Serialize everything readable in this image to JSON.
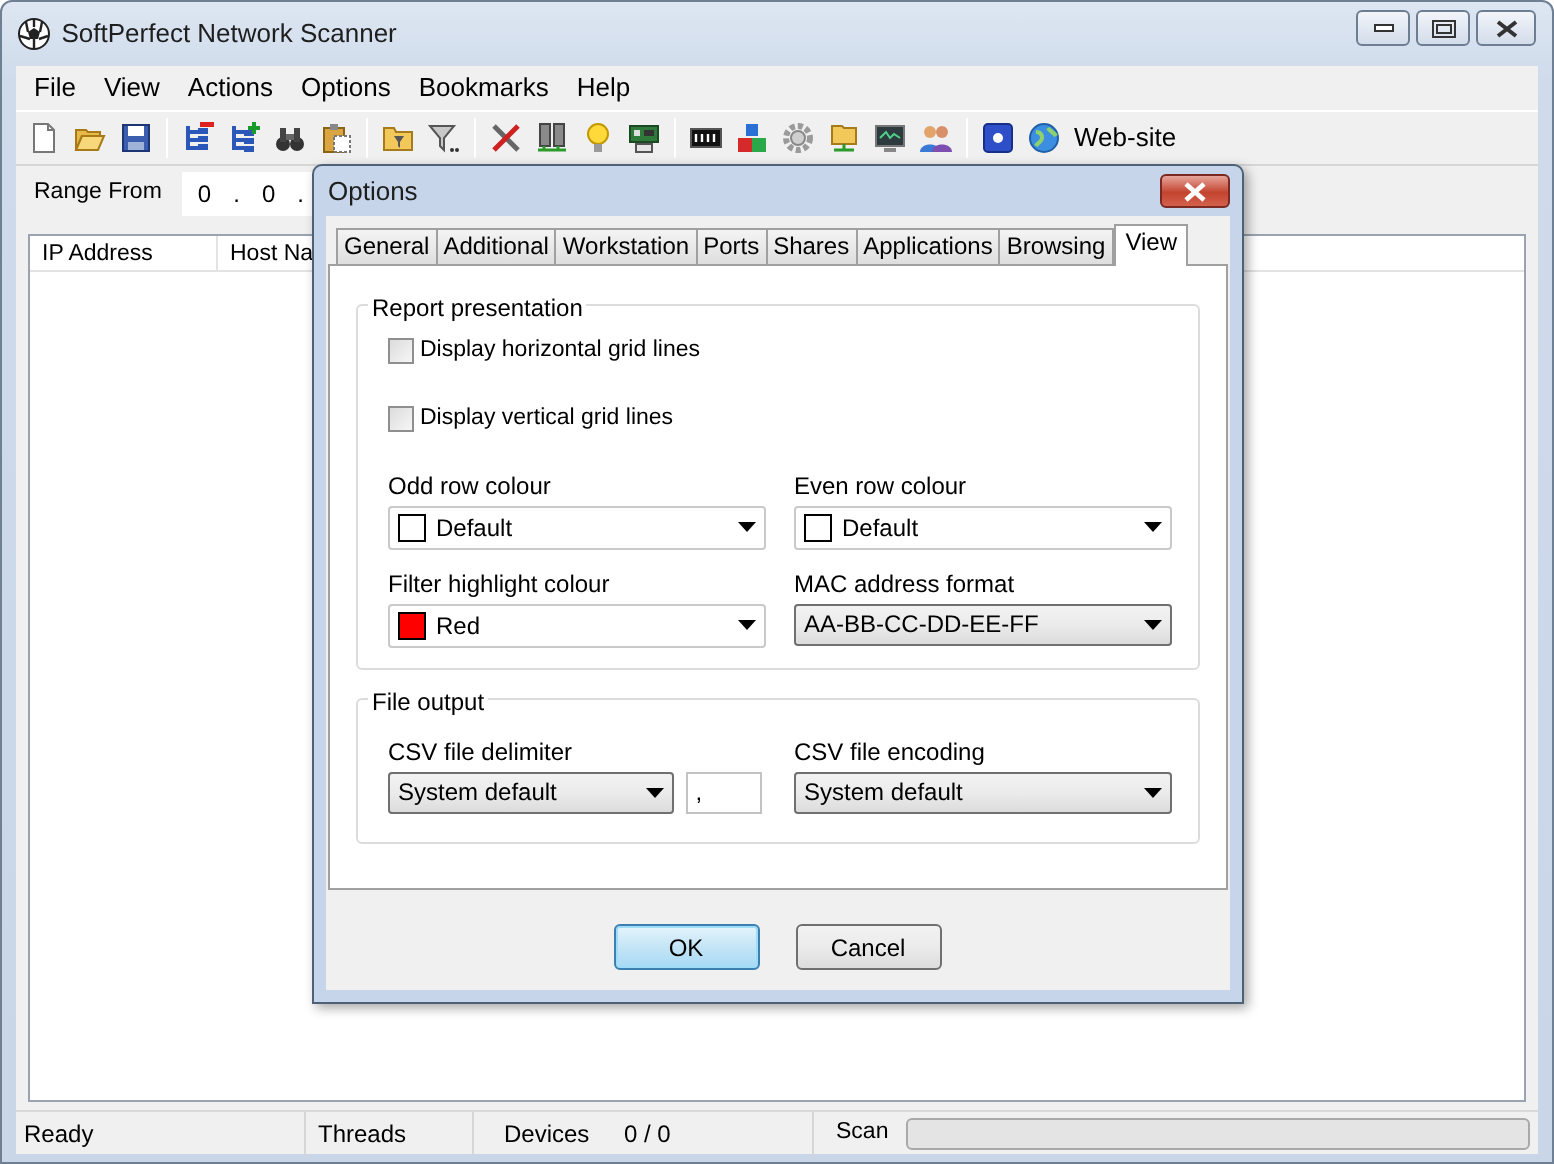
{
  "window": {
    "title": "SoftPerfect Network Scanner"
  },
  "menu": [
    "File",
    "View",
    "Actions",
    "Options",
    "Bookmarks",
    "Help"
  ],
  "toolbar": {
    "link": "Web-site"
  },
  "range": {
    "label": "Range From",
    "parts": [
      "0",
      ".",
      "0",
      "."
    ]
  },
  "table": {
    "columns": [
      "IP Address",
      "Host Na"
    ]
  },
  "status_bar": {
    "ready": "Ready",
    "threads": "Threads",
    "devices_label": "Devices",
    "devices": "0 / 0",
    "scan": "Scan",
    "level": 0
  },
  "dialog": {
    "title": "Options",
    "tabs": [
      {
        "label": "General",
        "selected": false
      },
      {
        "label": "Additional",
        "selected": false
      },
      {
        "label": "Workstation",
        "selected": false
      },
      {
        "label": "Ports",
        "selected": false
      },
      {
        "label": "Shares",
        "selected": false
      },
      {
        "label": "Applications",
        "selected": false
      },
      {
        "label": "Browsing",
        "selected": false
      },
      {
        "label": "View",
        "selected": true
      }
    ],
    "report": {
      "title": "Report presentation",
      "checkboxes": [
        {
          "label": "Display horizontal grid lines",
          "checked": false
        },
        {
          "label": "Display vertical grid lines",
          "checked": false
        }
      ],
      "fields": [
        {
          "label": "Odd row colour",
          "kind": "color",
          "value": "Default",
          "color": "#ffffff"
        },
        {
          "label": "Even row colour",
          "kind": "color",
          "value": "Default",
          "color": "#ffffff"
        },
        {
          "label": "Filter highlight colour",
          "kind": "color",
          "value": "Red",
          "color": "#ff0000"
        },
        {
          "label": "MAC address format",
          "kind": "combo",
          "value": "AA-BB-CC-DD-EE-FF"
        }
      ]
    },
    "file_output": {
      "title": "File output",
      "delimiter": {
        "label": "CSV file delimiter",
        "value": "System default",
        "char": ","
      },
      "encoding": {
        "label": "CSV file encoding",
        "value": "System default"
      }
    },
    "buttons": [
      {
        "label": "OK",
        "default": true
      },
      {
        "label": "Cancel",
        "default": false
      }
    ]
  }
}
